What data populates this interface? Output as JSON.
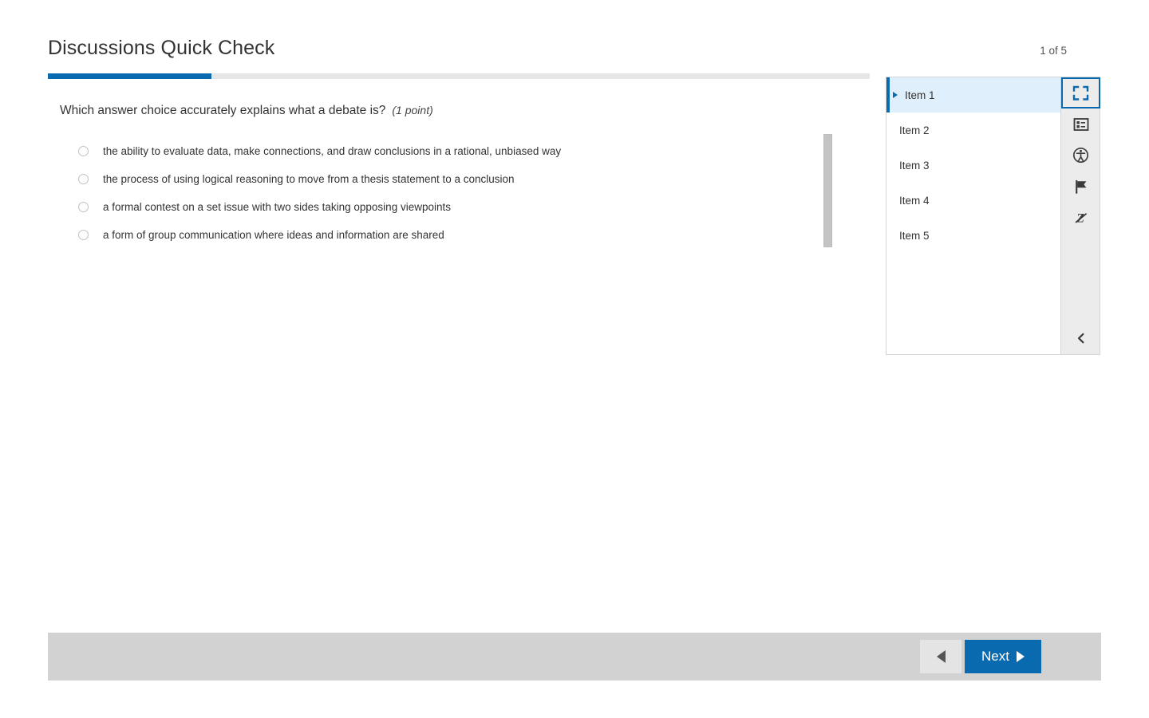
{
  "header": {
    "title": "Discussions Quick Check",
    "counter": "1 of 5"
  },
  "progress": {
    "percent": 20
  },
  "question": {
    "stem": "Which answer choice accurately explains what a debate is?",
    "points": "(1 point)",
    "choices": [
      {
        "label": "the ability to evaluate data, make connections, and draw conclusions in a rational, unbiased way",
        "selected": false
      },
      {
        "label": "the process of using logical reasoning to move from a thesis statement to a conclusion",
        "selected": false
      },
      {
        "label": "a formal contest on a set issue with two sides taking opposing viewpoints",
        "selected": false
      },
      {
        "label": "a form of group communication where ideas and information are shared",
        "selected": false
      }
    ]
  },
  "item_panel": {
    "items": [
      {
        "label": "Item 1",
        "selected": true
      },
      {
        "label": "Item 2",
        "selected": false
      },
      {
        "label": "Item 3",
        "selected": false
      },
      {
        "label": "Item 4",
        "selected": false
      },
      {
        "label": "Item 5",
        "selected": false
      }
    ]
  },
  "tool_rail": {
    "tools": [
      {
        "name": "fullscreen-icon",
        "active": true
      },
      {
        "name": "item-list-icon",
        "active": false
      },
      {
        "name": "accessibility-icon",
        "active": false
      },
      {
        "name": "flag-icon",
        "active": false
      },
      {
        "name": "eliminate-choice-icon",
        "active": false
      }
    ],
    "collapse": {
      "name": "chevron-left-icon"
    }
  },
  "footer": {
    "back_label": "",
    "next_label": "Next"
  },
  "colors": {
    "accent": "#0a6ab0",
    "selected_row": "#dfeffb",
    "footer_bg": "#d2d2d2",
    "progress_track": "#e6e6e6"
  }
}
